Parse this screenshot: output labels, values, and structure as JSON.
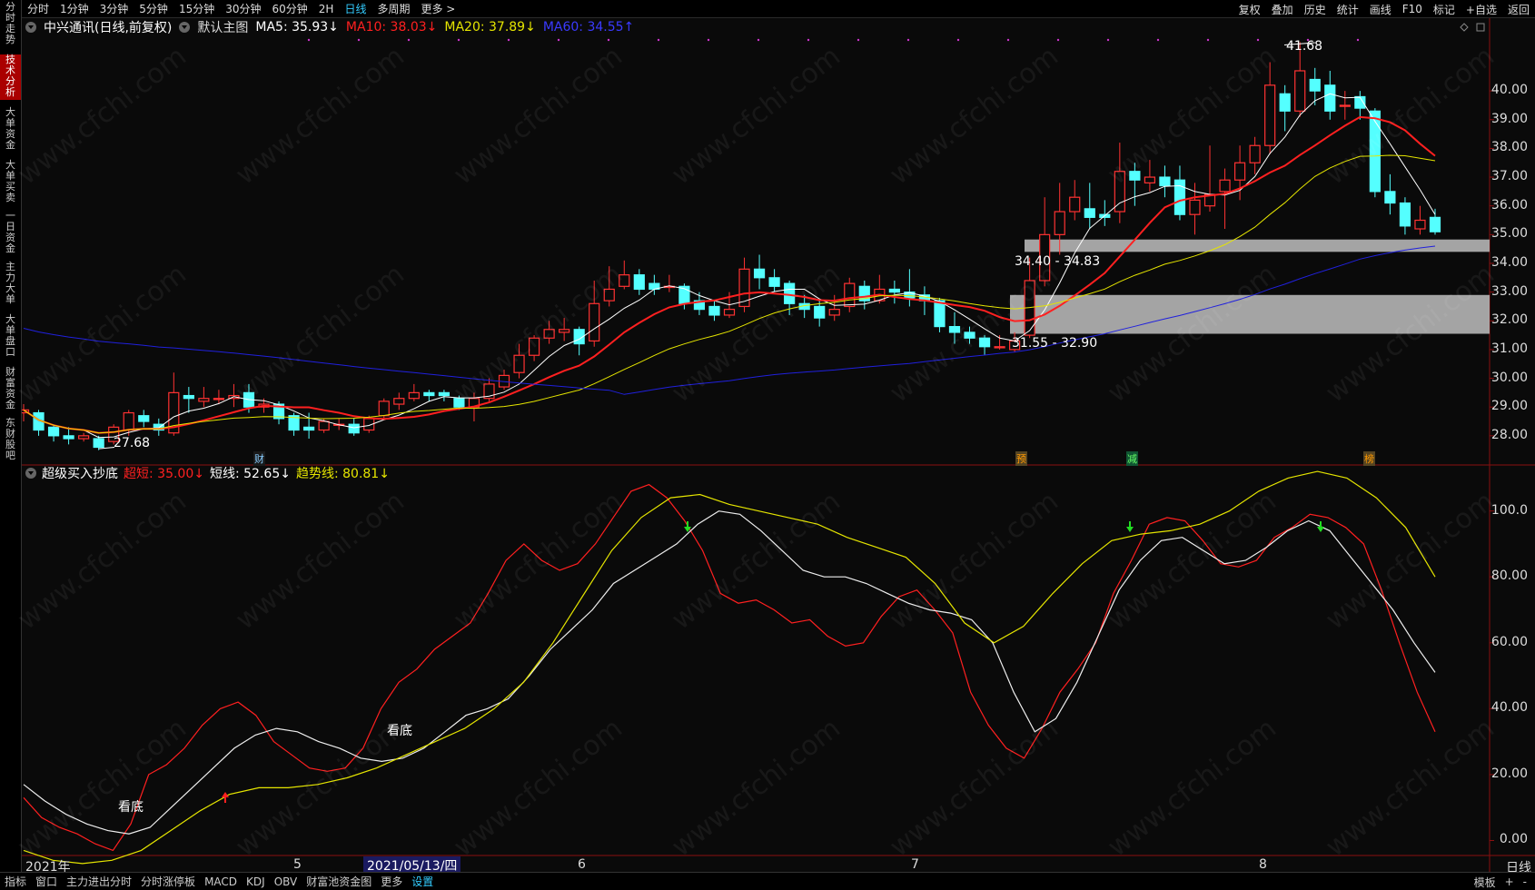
{
  "top_tabs": [
    "分时",
    "1分钟",
    "3分钟",
    "5分钟",
    "15分钟",
    "30分钟",
    "60分钟",
    "2H",
    "日线",
    "多周期",
    "更多 >"
  ],
  "active_tab": "日线",
  "top_right": [
    "复权",
    "叠加",
    "历史",
    "统计",
    "画线",
    "F10",
    "标记",
    "+自选",
    "返回"
  ],
  "left_nav": [
    {
      "label": "分时走势",
      "active": false
    },
    {
      "label": "技术分析",
      "active": true
    },
    {
      "label": "大单资金",
      "active": false
    },
    {
      "label": "大单买卖",
      "active": false
    },
    {
      "label": "一日资金",
      "active": false
    },
    {
      "label": "主力大单",
      "active": false
    },
    {
      "label": "大单盘口",
      "active": false
    },
    {
      "label": "财富资金",
      "active": false
    },
    {
      "label": "东财股吧",
      "active": false
    }
  ],
  "price_header": {
    "stock": "中兴通讯(日线,前复权)",
    "template": "默认主图",
    "ma5": "MA5: 35.93↓",
    "ma10": "MA10: 38.03↓",
    "ma20": "MA20: 37.89↓",
    "ma60": "MA60: 34.55↑"
  },
  "indicator_header": {
    "name": "超级买入抄底",
    "super_short": "超短: 35.00↓",
    "short": "短线: 52.65↓",
    "trend": "趋势线: 80.81↓"
  },
  "price_axis": [
    "40.00",
    "39.00",
    "38.00",
    "37.00",
    "36.00",
    "35.00",
    "34.00",
    "33.00",
    "32.00",
    "31.00",
    "30.00",
    "29.00",
    "28.00"
  ],
  "ind_axis": [
    "100.0",
    "80.00",
    "60.00",
    "40.00",
    "20.00",
    "0.00"
  ],
  "x_axis": {
    "year": "2021年",
    "m5": "5",
    "m6": "6",
    "m7": "7",
    "m8": "8",
    "cursor_date": "2021/05/13/四"
  },
  "annotations": {
    "high": "41.68",
    "low": "27.68",
    "zone_upper": "34.40 - 34.83",
    "zone_lower": "31.55 - 32.90",
    "bottom_signal": "看底"
  },
  "markers": {
    "cai": "财",
    "yu": "预",
    "jian": "减",
    "bang": "榜"
  },
  "bottom_tabs": [
    "指标",
    "窗口",
    "主力进出分时",
    "分时涨停板",
    "MACD",
    "KDJ",
    "OBV",
    "财富池资金图",
    "更多",
    "设置"
  ],
  "bottom_active": "设置",
  "bottom_right": [
    "模板",
    "+",
    "-"
  ],
  "period_label": "日线",
  "watermark": "www.cfchi.com",
  "colors": {
    "up": "#ff3232",
    "down": "#54ffff",
    "ma5": "#ffffff",
    "ma10": "#ff2020",
    "ma20": "#e5e500",
    "ma60": "#2020dd",
    "bg": "#0a0a0a",
    "zone": "#c0c0c0"
  },
  "chart_data": {
    "type": "candlestick",
    "x_range": [
      "2021-04",
      "2021-08"
    ],
    "price_ylim": [
      27.3,
      41.9
    ],
    "candles": [
      [
        28.8,
        28.9,
        28.5,
        29.1
      ],
      [
        28.8,
        28.2,
        28.0,
        28.9
      ],
      [
        28.3,
        28.0,
        27.8,
        28.4
      ],
      [
        28.0,
        27.9,
        27.7,
        28.3
      ],
      [
        27.9,
        28.0,
        27.8,
        28.1
      ],
      [
        27.9,
        27.6,
        27.5,
        28.0
      ],
      [
        27.8,
        28.3,
        27.7,
        28.4
      ],
      [
        28.2,
        28.8,
        28.0,
        28.9
      ],
      [
        28.7,
        28.5,
        28.3,
        28.9
      ],
      [
        28.4,
        28.2,
        28.0,
        28.6
      ],
      [
        28.1,
        29.5,
        28.0,
        30.2
      ],
      [
        29.4,
        29.3,
        28.8,
        29.7
      ],
      [
        29.2,
        29.3,
        29.0,
        29.7
      ],
      [
        29.3,
        29.3,
        29.1,
        29.6
      ],
      [
        29.3,
        29.4,
        29.0,
        29.8
      ],
      [
        29.5,
        29.0,
        28.8,
        29.8
      ],
      [
        29.0,
        29.1,
        28.8,
        29.3
      ],
      [
        29.1,
        28.6,
        28.4,
        29.2
      ],
      [
        28.7,
        28.2,
        28.0,
        28.8
      ],
      [
        28.3,
        28.2,
        27.9,
        28.8
      ],
      [
        28.2,
        28.5,
        28.1,
        28.6
      ],
      [
        28.4,
        28.4,
        28.2,
        28.6
      ],
      [
        28.4,
        28.1,
        28.0,
        28.6
      ],
      [
        28.2,
        28.6,
        28.1,
        28.7
      ],
      [
        28.7,
        29.2,
        28.6,
        29.3
      ],
      [
        29.1,
        29.3,
        28.9,
        29.5
      ],
      [
        29.3,
        29.5,
        29.2,
        29.8
      ],
      [
        29.5,
        29.4,
        29.2,
        29.6
      ],
      [
        29.5,
        29.4,
        29.2,
        29.6
      ],
      [
        29.3,
        29.0,
        28.9,
        29.4
      ],
      [
        29.0,
        29.3,
        28.5,
        29.5
      ],
      [
        29.3,
        29.8,
        29.2,
        30.0
      ],
      [
        29.7,
        30.1,
        29.6,
        30.3
      ],
      [
        30.2,
        30.8,
        30.0,
        31.2
      ],
      [
        30.8,
        31.4,
        30.6,
        31.5
      ],
      [
        31.4,
        31.7,
        31.2,
        32.0
      ],
      [
        31.6,
        31.7,
        31.3,
        32.1
      ],
      [
        31.7,
        31.2,
        30.8,
        31.8
      ],
      [
        31.3,
        32.6,
        31.1,
        33.4
      ],
      [
        32.7,
        33.1,
        32.5,
        33.9
      ],
      [
        33.2,
        33.6,
        33.1,
        34.1
      ],
      [
        33.6,
        33.1,
        32.9,
        33.8
      ],
      [
        33.3,
        33.1,
        32.9,
        33.6
      ],
      [
        33.2,
        33.2,
        33.0,
        33.6
      ],
      [
        33.2,
        32.6,
        32.4,
        33.3
      ],
      [
        32.7,
        32.4,
        32.2,
        33.0
      ],
      [
        32.5,
        32.2,
        32.0,
        32.7
      ],
      [
        32.2,
        32.4,
        32.1,
        33.0
      ],
      [
        32.5,
        33.8,
        32.3,
        34.2
      ],
      [
        33.8,
        33.5,
        33.1,
        34.3
      ],
      [
        33.5,
        33.2,
        33.0,
        33.8
      ],
      [
        33.3,
        32.6,
        32.2,
        33.4
      ],
      [
        32.6,
        32.4,
        32.1,
        32.9
      ],
      [
        32.5,
        32.1,
        31.8,
        32.7
      ],
      [
        32.2,
        32.4,
        32.0,
        32.9
      ],
      [
        32.5,
        33.3,
        32.3,
        33.5
      ],
      [
        33.2,
        32.7,
        32.4,
        33.4
      ],
      [
        32.7,
        33.1,
        32.6,
        33.6
      ],
      [
        33.1,
        33.0,
        32.6,
        33.4
      ],
      [
        33.0,
        32.8,
        32.5,
        33.8
      ],
      [
        32.9,
        32.7,
        32.2,
        33.2
      ],
      [
        32.7,
        31.8,
        31.6,
        32.8
      ],
      [
        31.8,
        31.6,
        31.2,
        32.3
      ],
      [
        31.6,
        31.4,
        31.2,
        31.8
      ],
      [
        31.4,
        31.1,
        30.8,
        31.5
      ],
      [
        31.1,
        31.1,
        31.0,
        31.5
      ],
      [
        31.0,
        31.3,
        30.9,
        31.6
      ],
      [
        31.5,
        33.4,
        31.4,
        34.2
      ],
      [
        33.4,
        35.0,
        33.2,
        36.3
      ],
      [
        35.0,
        35.8,
        34.3,
        36.8
      ],
      [
        35.8,
        36.3,
        35.5,
        36.9
      ],
      [
        35.9,
        35.6,
        35.2,
        36.8
      ],
      [
        35.7,
        35.6,
        35.3,
        36.2
      ],
      [
        35.8,
        37.2,
        35.4,
        38.2
      ],
      [
        37.2,
        36.9,
        36.0,
        37.5
      ],
      [
        36.8,
        37.0,
        36.5,
        37.6
      ],
      [
        37.0,
        36.7,
        36.3,
        37.4
      ],
      [
        36.9,
        35.7,
        35.5,
        37.4
      ],
      [
        35.7,
        36.2,
        35.0,
        36.8
      ],
      [
        36.0,
        36.4,
        35.8,
        38.1
      ],
      [
        36.5,
        36.9,
        35.2,
        37.3
      ],
      [
        36.9,
        37.5,
        36.2,
        38.1
      ],
      [
        37.5,
        38.1,
        37.1,
        38.4
      ],
      [
        38.1,
        40.2,
        37.8,
        41.0
      ],
      [
        39.9,
        39.3,
        38.6,
        40.2
      ],
      [
        39.3,
        40.7,
        39.1,
        41.7
      ],
      [
        40.4,
        40.0,
        39.5,
        40.8
      ],
      [
        40.2,
        39.3,
        39.0,
        40.7
      ],
      [
        39.5,
        39.5,
        39.0,
        40.0
      ],
      [
        39.8,
        39.4,
        39.0,
        40.0
      ],
      [
        39.3,
        36.5,
        36.3,
        39.4
      ],
      [
        36.5,
        36.1,
        35.7,
        37.1
      ],
      [
        36.1,
        35.3,
        35.0,
        36.3
      ],
      [
        35.2,
        35.5,
        35.0,
        36.0
      ],
      [
        35.6,
        35.1,
        35.0,
        35.9
      ]
    ],
    "indicator": {
      "name": "超级买入抄底",
      "ylim": [
        -4,
        109
      ],
      "series": [
        {
          "name": "超短",
          "color": "#ff2020",
          "values": [
            13,
            7,
            4,
            2,
            -1,
            -3,
            5,
            20,
            23,
            28,
            35,
            40,
            42,
            38,
            30,
            26,
            22,
            21,
            22,
            28,
            40,
            48,
            52,
            58,
            62,
            66,
            75,
            85,
            90,
            85,
            82,
            84,
            90,
            98,
            106,
            108,
            104,
            97,
            88,
            75,
            72,
            73,
            70,
            66,
            67,
            62,
            59,
            60,
            68,
            74,
            76,
            70,
            63,
            45,
            35,
            28,
            25,
            34,
            45,
            52,
            60,
            75,
            85,
            96,
            98,
            97,
            91,
            84,
            83,
            85,
            92,
            95,
            99,
            98,
            95,
            90,
            76,
            60,
            45,
            33
          ]
        },
        {
          "name": "短线",
          "color": "#eeeeee",
          "values": [
            17,
            12,
            8,
            5,
            3,
            2,
            4,
            10,
            16,
            22,
            28,
            32,
            34,
            33,
            30,
            28,
            25,
            24,
            25,
            28,
            33,
            38,
            40,
            43,
            50,
            58,
            64,
            70,
            78,
            82,
            86,
            90,
            96,
            100,
            99,
            94,
            88,
            82,
            80,
            80,
            78,
            75,
            72,
            70,
            69,
            67,
            60,
            45,
            33,
            37,
            48,
            62,
            76,
            85,
            91,
            92,
            88,
            84,
            85,
            89,
            94,
            97,
            94,
            86,
            78,
            70,
            60,
            51
          ]
        },
        {
          "name": "趋势线",
          "color": "#e5e500",
          "values": [
            -3,
            -6,
            -7,
            -6,
            -3,
            3,
            9,
            14,
            16,
            16,
            17,
            19,
            22,
            26,
            30,
            34,
            40,
            48,
            60,
            74,
            88,
            98,
            104,
            105,
            102,
            100,
            98,
            96,
            92,
            89,
            86,
            78,
            66,
            60,
            65,
            75,
            84,
            91,
            93,
            94,
            96,
            100,
            106,
            110,
            112,
            110,
            104,
            95,
            80
          ]
        }
      ]
    }
  }
}
